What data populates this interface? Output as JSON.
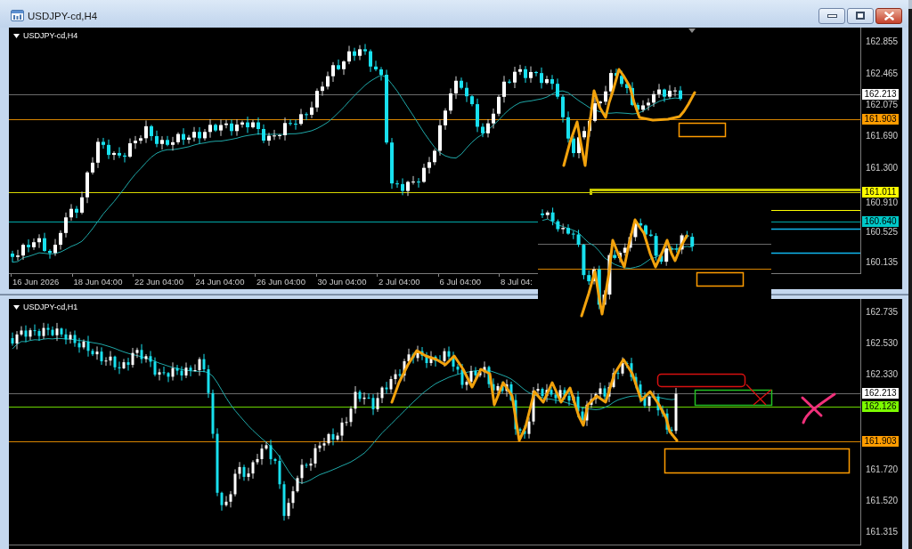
{
  "window": {
    "title": "USDJPY-cd,H4"
  },
  "charts": [
    {
      "title": "USDJPY-cd,H4",
      "price_axis": [
        "162.855",
        "162.465",
        "162.075",
        "161.690",
        "161.300",
        "160.910",
        "160.525",
        "160.135"
      ],
      "price_tags": [
        {
          "text": "162.213",
          "kind": "bid",
          "color": "#ffffff"
        },
        {
          "text": "161.903",
          "kind": "level",
          "color": "#ff9c00"
        },
        {
          "text": "161.011",
          "kind": "level",
          "color": "#ffff00"
        },
        {
          "text": "160.640",
          "kind": "level",
          "color": "#00c8c8"
        }
      ],
      "time_axis": [
        "16 Jun 2026",
        "18 Jun 04:00",
        "22 Jun 04:00",
        "24 Jun 04:00",
        "26 Jun 04:00",
        "30 Jun 04:00",
        "2 Jul 04:00",
        "6 Jul 04:00",
        "8 Jul 04:"
      ]
    },
    {
      "title": "USDJPY-cd,H1",
      "price_axis": [
        "162.735",
        "162.530",
        "162.330",
        "161.720",
        "161.520",
        "161.315"
      ],
      "price_tags": [
        {
          "text": "162.213",
          "kind": "bid",
          "color": "#ffffff"
        },
        {
          "text": "162.126",
          "kind": "level",
          "color": "#7cfc00"
        },
        {
          "text": "161.903",
          "kind": "level",
          "color": "#ff9c00"
        }
      ]
    }
  ]
}
